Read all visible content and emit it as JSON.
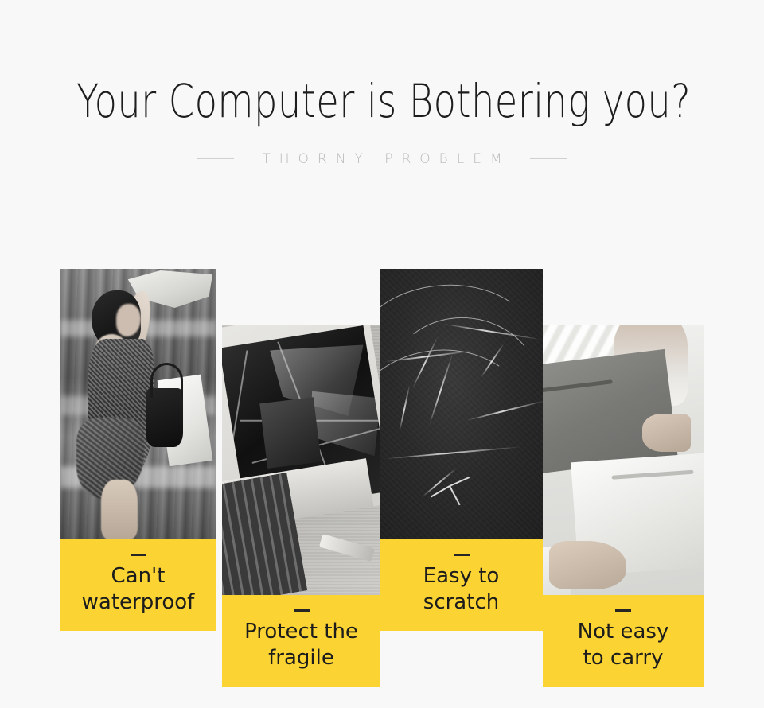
{
  "header": {
    "title": "Your Computer is Bothering you?",
    "subtitle": "THORNY PROBLEM"
  },
  "colors": {
    "background": "#f8f8f8",
    "accent_yellow": "#fbd434",
    "title_text": "#1d1d1d",
    "subtitle_text": "#b9b9bb",
    "label_text": "#1c1c1c",
    "rule": "#cfcfcf"
  },
  "cards": [
    {
      "id": "cant-waterproof",
      "label": "Can't\nwaterproof",
      "image_alt": "woman shielding herself from rain with a shopping bag"
    },
    {
      "id": "protect-the-fragile",
      "label": "Protect the\nfragile",
      "image_alt": "broken laptop with smashed screen on the ground"
    },
    {
      "id": "easy-to-scratch",
      "label": "Easy to\nscratch",
      "image_alt": "dark surface covered in fine scratches"
    },
    {
      "id": "not-easy-to-carry",
      "label": "Not easy\nto carry",
      "image_alt": "hands holding two large flat bags"
    }
  ]
}
